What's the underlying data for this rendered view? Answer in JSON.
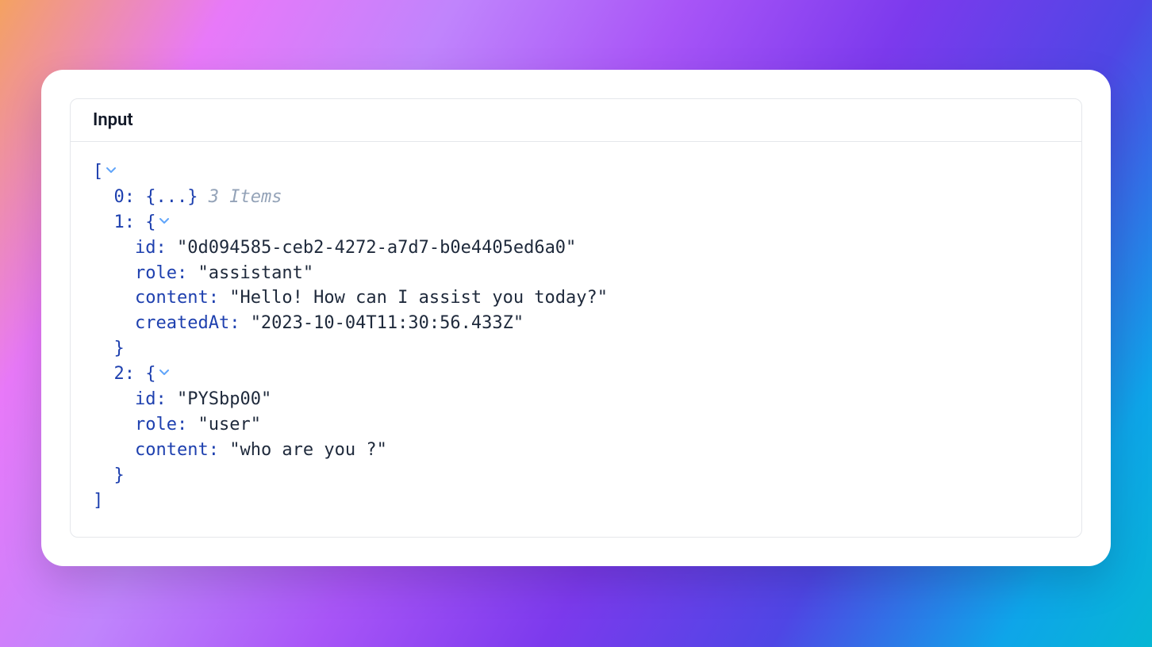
{
  "panel_title": "Input",
  "json": {
    "collapsed_hint": "3 Items",
    "item0_collapsed": "{...}",
    "item1": {
      "id": "\"0d094585-ceb2-4272-a7d7-b0e4405ed6a0\"",
      "role": "\"assistant\"",
      "content": "\"Hello! How can I assist you today?\"",
      "createdAt": "\"2023-10-04T11:30:56.433Z\""
    },
    "item2": {
      "id": "\"PYSbp00\"",
      "role": "\"user\"",
      "content": "\"who are you ?\""
    }
  },
  "labels": {
    "idx0": "0:",
    "idx1": "1:",
    "idx2": "2:",
    "id": "id:",
    "role": "role:",
    "content": "content:",
    "createdAt": "createdAt:",
    "open_bracket": "[",
    "close_bracket": "]",
    "open_brace": "{",
    "close_brace": "}"
  }
}
